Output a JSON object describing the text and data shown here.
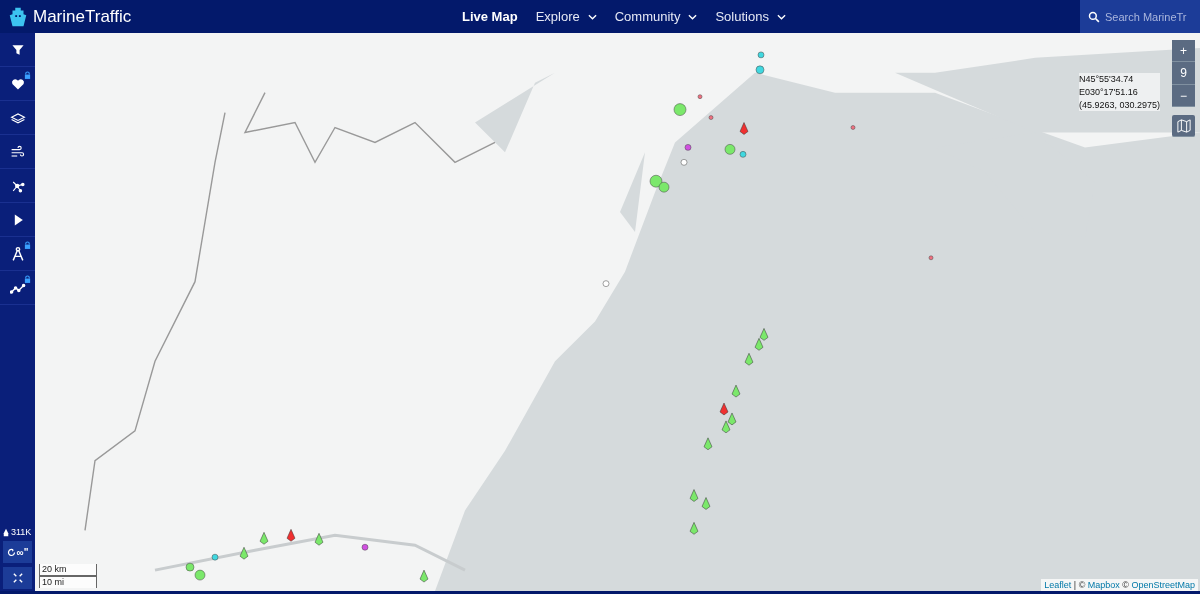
{
  "header": {
    "brand": "MarineTraffic",
    "nav": [
      {
        "label": "Live Map",
        "selected": true,
        "dropdown": false
      },
      {
        "label": "Explore",
        "selected": false,
        "dropdown": true
      },
      {
        "label": "Community",
        "selected": false,
        "dropdown": true
      },
      {
        "label": "Solutions",
        "selected": false,
        "dropdown": true
      }
    ],
    "search": {
      "placeholder": "Search MarineTr"
    }
  },
  "sidebar": {
    "items": [
      {
        "kind": "filter",
        "locked": false
      },
      {
        "kind": "heart",
        "locked": true
      },
      {
        "kind": "layers",
        "locked": false
      },
      {
        "kind": "wind",
        "locked": false
      },
      {
        "kind": "network",
        "locked": false
      },
      {
        "kind": "play",
        "locked": false
      },
      {
        "kind": "compass",
        "locked": true
      },
      {
        "kind": "graph",
        "locked": true
      }
    ],
    "vessel_count": "311K",
    "refresh_label": "∞\""
  },
  "map": {
    "coordinates": [
      "N45°55'34.74",
      "E030°17'51.16",
      "(45.9263, 030.2975)"
    ],
    "zoom": {
      "plus": "+",
      "level": "9",
      "minus": "−"
    },
    "scale": [
      "20 km",
      "10 mi"
    ],
    "attribution": [
      {
        "text": "Leaflet",
        "link": true
      },
      {
        "text": " | © ",
        "link": false
      },
      {
        "text": "Mapbox",
        "link": true
      },
      {
        "text": " © ",
        "link": false
      },
      {
        "text": "OpenStreetMap",
        "link": true
      }
    ]
  }
}
